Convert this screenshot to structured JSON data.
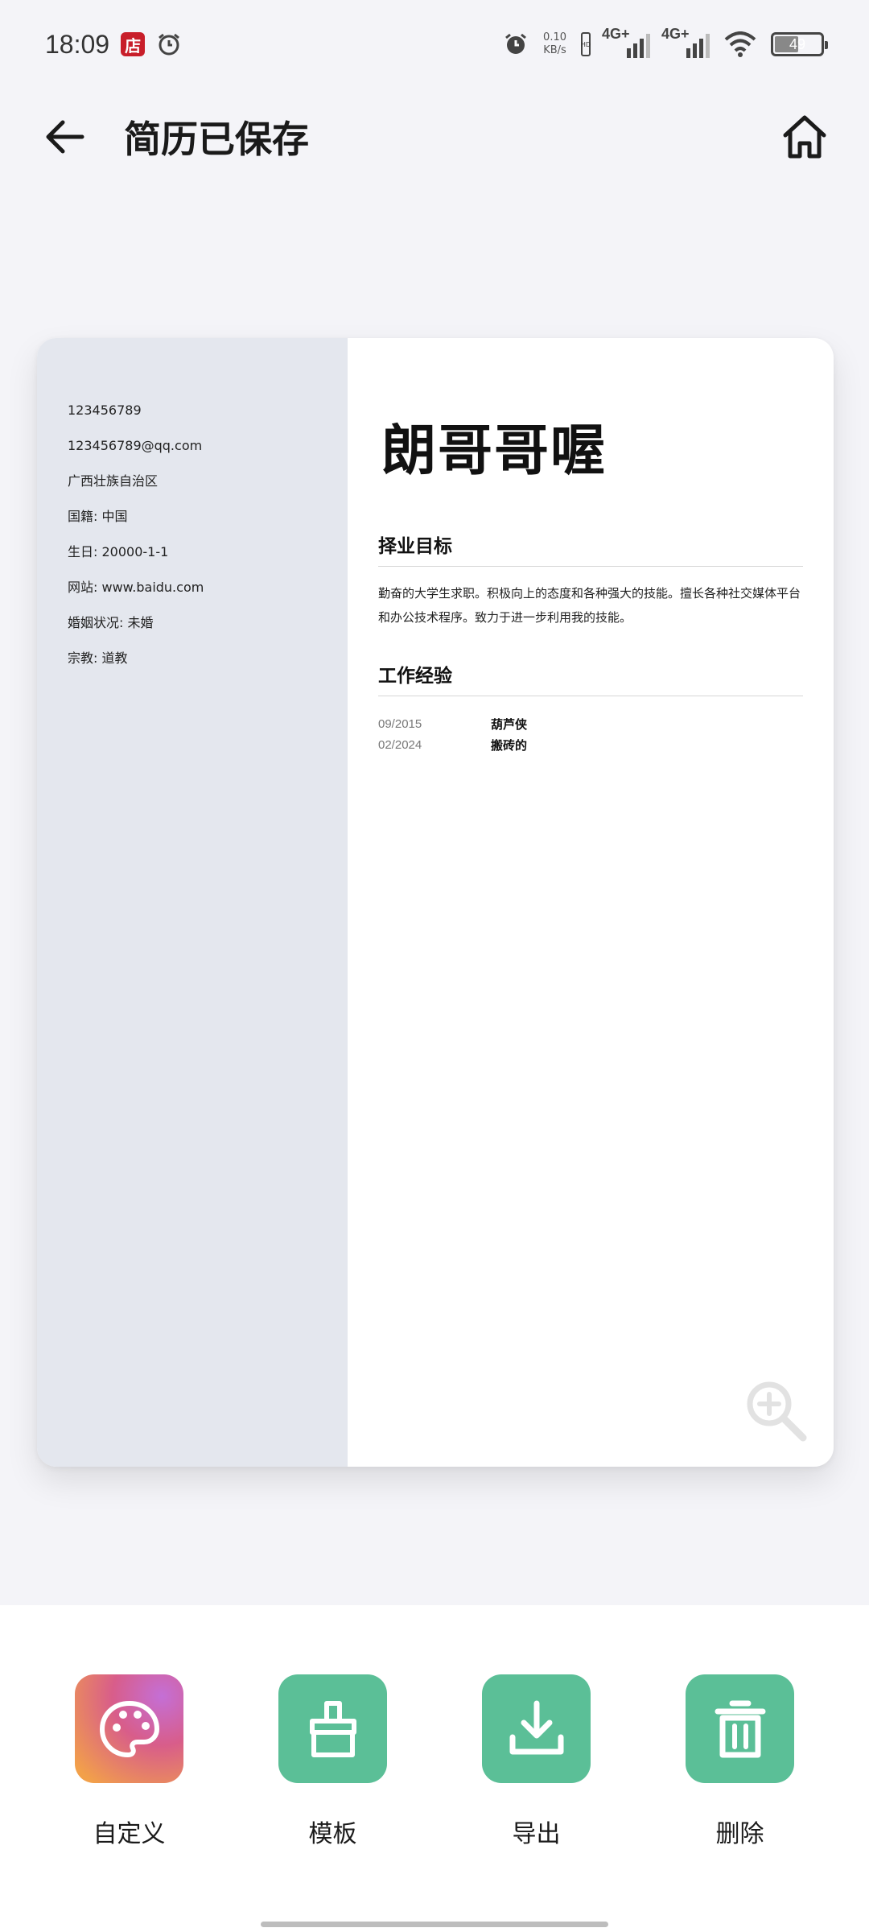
{
  "status_bar": {
    "time": "18:09",
    "shop_badge": "店",
    "net_speed_value": "0.10",
    "net_speed_unit": "KB/s",
    "hd_label": "HD",
    "signal1_label": "4G+",
    "signal2_label": "4G+",
    "battery_level": "49"
  },
  "app_bar": {
    "title": "简历已保存",
    "back_icon": "arrow-left-icon",
    "home_icon": "home-icon"
  },
  "resume": {
    "name": "朗哥哥喔",
    "contacts": [
      "123456789",
      "123456789@qq.com",
      "广西壮族自治区",
      "国籍: 中国",
      "生日: 20000-1-1",
      "网站: www.baidu.com",
      "婚姻状况: 未婚",
      "宗教: 道教"
    ],
    "objective_title": "择业目标",
    "objective_text": "勤奋的大学生求职。积极向上的态度和各种强大的技能。擅长各种社交媒体平台和办公技术程序。致力于进一步利用我的技能。",
    "experience_title": "工作经验",
    "experience": [
      {
        "date": "09/2015",
        "text": "葫芦侠"
      },
      {
        "date": "02/2024",
        "text": "搬砖的"
      }
    ],
    "zoom_icon": "zoom-in-icon"
  },
  "actions": [
    {
      "label": "自定义",
      "icon": "palette-icon"
    },
    {
      "label": "模板",
      "icon": "brush-icon"
    },
    {
      "label": "导出",
      "icon": "download-icon"
    },
    {
      "label": "删除",
      "icon": "trash-icon"
    }
  ],
  "colors": {
    "accent_green": "#5bbf97",
    "sidebar_gray": "#e4e7ee",
    "background": "#f4f4f8"
  }
}
